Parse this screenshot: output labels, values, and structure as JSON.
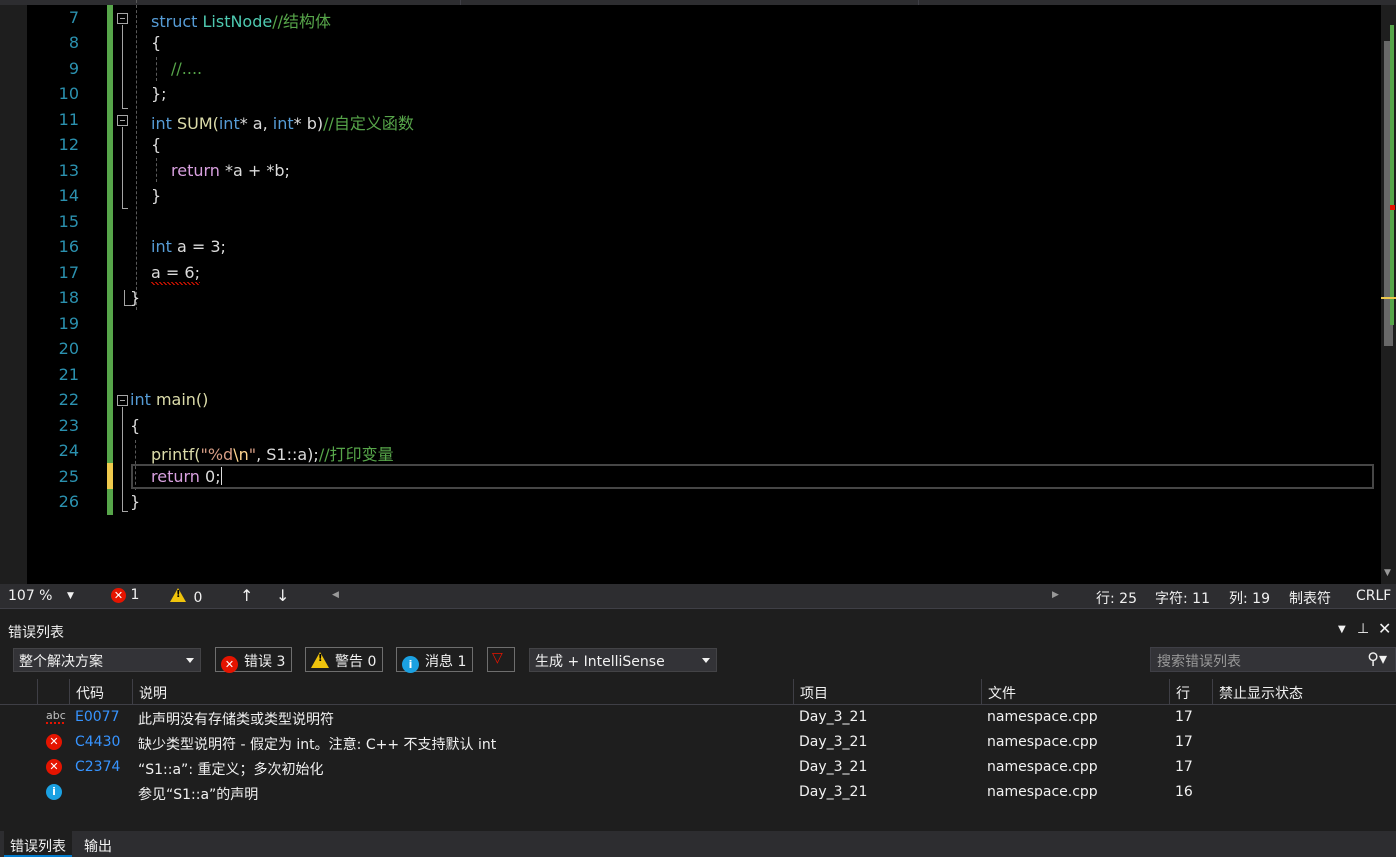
{
  "editor": {
    "lines": [
      {
        "num": "7"
      },
      {
        "num": "8"
      },
      {
        "num": "9"
      },
      {
        "num": "10"
      },
      {
        "num": "11"
      },
      {
        "num": "12"
      },
      {
        "num": "13"
      },
      {
        "num": "14"
      },
      {
        "num": "15"
      },
      {
        "num": "16"
      },
      {
        "num": "17"
      },
      {
        "num": "18"
      },
      {
        "num": "19"
      },
      {
        "num": "20"
      },
      {
        "num": "21"
      },
      {
        "num": "22"
      },
      {
        "num": "23"
      },
      {
        "num": "24"
      },
      {
        "num": "25"
      },
      {
        "num": "26"
      }
    ],
    "code": {
      "l7_kw": "struct",
      "l7_name": " ListNode",
      "l7_cm": "//结构体",
      "l8": "{",
      "l9_cm": "//....",
      "l10": "};",
      "l11_kw": "int",
      "l11_fn": " SUM(",
      "l11_kw2": "int",
      "l11_a": "* a, ",
      "l11_kw3": "int",
      "l11_b": "* b)",
      "l11_cm": "//自定义函数",
      "l12": "{",
      "l13_kw": "return",
      "l13_rest": " *a + *b;",
      "l14": "}",
      "l16_kw": "int",
      "l16_rest": " a = 3;",
      "l17": "a = 6;",
      "l18": "}",
      "l22_kw": "int",
      "l22_rest": " main()",
      "l23": "{",
      "l24_fn": "printf(",
      "l24_str1": "\"%d",
      "l24_esc": "\\n",
      "l24_str2": "\"",
      "l24_rest": ", S1::a);",
      "l24_cm": "//打印变量",
      "l25_kw": "return",
      "l25_rest": " 0;",
      "l26": "}"
    }
  },
  "status_bar": {
    "zoom": "107 %",
    "errors": "1",
    "warnings": "0",
    "line": "行: 25",
    "char": "字符: 11",
    "col": "列: 19",
    "tabs": "制表符",
    "eol": "CRLF"
  },
  "error_list": {
    "title": "错误列表",
    "scope": "整个解决方案",
    "errors_btn": "错误 3",
    "warnings_btn": "警告 0",
    "messages_btn": "消息 1",
    "build_filter": "生成 + IntelliSense",
    "search_placeholder": "搜索错误列表",
    "columns": {
      "code": "代码",
      "desc": "说明",
      "project": "项目",
      "file": "文件",
      "line": "行",
      "suppress": "禁止显示状态"
    },
    "rows": [
      {
        "code": "E0077",
        "desc": "此声明没有存储类或类型说明符",
        "project": "Day_3_21",
        "file": "namespace.cpp",
        "line": "17"
      },
      {
        "code": "C4430",
        "desc": "缺少类型说明符 - 假定为 int。注意: C++ 不支持默认 int",
        "project": "Day_3_21",
        "file": "namespace.cpp",
        "line": "17"
      },
      {
        "code": "C2374",
        "desc": "“S1::a”: 重定义；多次初始化",
        "project": "Day_3_21",
        "file": "namespace.cpp",
        "line": "17"
      },
      {
        "code": "",
        "desc": "参见“S1::a”的声明",
        "project": "Day_3_21",
        "file": "namespace.cpp",
        "line": "16"
      }
    ],
    "row_icons": [
      "spelling-icon",
      "error-icon",
      "error-icon",
      "info-icon"
    ]
  },
  "bottom_tabs": [
    "错误列表",
    "输出"
  ],
  "colors": {
    "keyword": "#569cd6",
    "comment": "#57a64a",
    "line_number": "#2b91af",
    "error": "#e51400",
    "warning": "#f0c40c",
    "info": "#1ba1e2"
  }
}
